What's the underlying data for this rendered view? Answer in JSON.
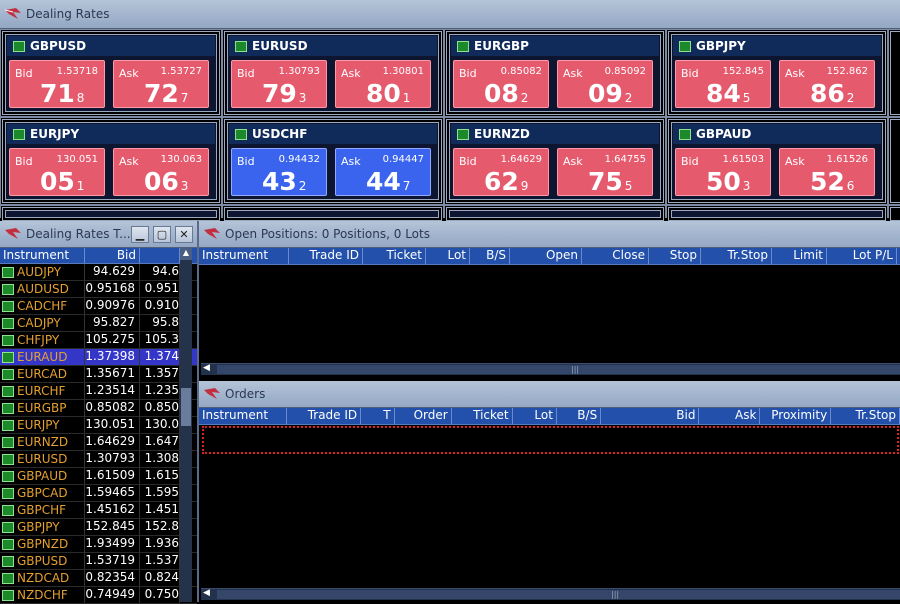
{
  "dealing_rates": {
    "title": "Dealing Rates",
    "tiles": [
      {
        "symbol": "GBPUSD",
        "bid": {
          "label": "Bid",
          "price": "1.53718",
          "big": "71",
          "small": "8"
        },
        "ask": {
          "label": "Ask",
          "price": "1.53727",
          "big": "72",
          "small": "7"
        },
        "color": "red"
      },
      {
        "symbol": "EURUSD",
        "bid": {
          "label": "Bid",
          "price": "1.30793",
          "big": "79",
          "small": "3"
        },
        "ask": {
          "label": "Ask",
          "price": "1.30801",
          "big": "80",
          "small": "1"
        },
        "color": "red"
      },
      {
        "symbol": "EURGBP",
        "bid": {
          "label": "Bid",
          "price": "0.85082",
          "big": "08",
          "small": "2"
        },
        "ask": {
          "label": "Ask",
          "price": "0.85092",
          "big": "09",
          "small": "2"
        },
        "color": "red"
      },
      {
        "symbol": "GBPJPY",
        "bid": {
          "label": "Bid",
          "price": "152.845",
          "big": "84",
          "small": "5"
        },
        "ask": {
          "label": "Ask",
          "price": "152.862",
          "big": "86",
          "small": "2"
        },
        "color": "red"
      },
      {
        "symbol": "EURJPY",
        "bid": {
          "label": "Bid",
          "price": "130.051",
          "big": "05",
          "small": "1"
        },
        "ask": {
          "label": "Ask",
          "price": "130.063",
          "big": "06",
          "small": "3"
        },
        "color": "red"
      },
      {
        "symbol": "USDCHF",
        "bid": {
          "label": "Bid",
          "price": "0.94432",
          "big": "43",
          "small": "2"
        },
        "ask": {
          "label": "Ask",
          "price": "0.94447",
          "big": "44",
          "small": "7"
        },
        "color": "blue"
      },
      {
        "symbol": "EURNZD",
        "bid": {
          "label": "Bid",
          "price": "1.64629",
          "big": "62",
          "small": "9"
        },
        "ask": {
          "label": "Ask",
          "price": "1.64755",
          "big": "75",
          "small": "5"
        },
        "color": "red"
      },
      {
        "symbol": "GBPAUD",
        "bid": {
          "label": "Bid",
          "price": "1.61503",
          "big": "50",
          "small": "3"
        },
        "ask": {
          "label": "Ask",
          "price": "1.61526",
          "big": "52",
          "small": "6"
        },
        "color": "red"
      }
    ]
  },
  "rates_table": {
    "title": "Dealing Rates T...",
    "columns": [
      "Instrument",
      "Bid",
      ""
    ],
    "rows": [
      [
        "AUDJPY",
        "94.629",
        "94.6"
      ],
      [
        "AUDUSD",
        "0.95168",
        "0.951"
      ],
      [
        "CADCHF",
        "0.90976",
        "0.910"
      ],
      [
        "CADJPY",
        "95.827",
        "95.8"
      ],
      [
        "CHFJPY",
        "105.275",
        "105.3"
      ],
      [
        "EURAUD",
        "1.37398",
        "1.374"
      ],
      [
        "EURCAD",
        "1.35671",
        "1.357"
      ],
      [
        "EURCHF",
        "1.23514",
        "1.235"
      ],
      [
        "EURGBP",
        "0.85082",
        "0.850"
      ],
      [
        "EURJPY",
        "130.051",
        "130.0"
      ],
      [
        "EURNZD",
        "1.64629",
        "1.647"
      ],
      [
        "EURUSD",
        "1.30793",
        "1.308"
      ],
      [
        "GBPAUD",
        "1.61509",
        "1.615"
      ],
      [
        "GBPCAD",
        "1.59465",
        "1.595"
      ],
      [
        "GBPCHF",
        "1.45162",
        "1.451"
      ],
      [
        "GBPJPY",
        "152.845",
        "152.8"
      ],
      [
        "GBPNZD",
        "1.93499",
        "1.936"
      ],
      [
        "GBPUSD",
        "1.53719",
        "1.537"
      ],
      [
        "NZDCAD",
        "0.82354",
        "0.824"
      ],
      [
        "NZDCHF",
        "0.74949",
        "0.750"
      ]
    ],
    "selected_index": 5
  },
  "open_positions": {
    "title": "Open Positions: 0 Positions, 0 Lots",
    "columns": [
      "Instrument",
      "Trade ID",
      "Ticket",
      "Lot",
      "B/S",
      "Open",
      "Close",
      "Stop",
      "Tr.Stop",
      "Limit",
      "Lot P/L"
    ]
  },
  "orders": {
    "title": "Orders",
    "columns": [
      "Instrument",
      "Trade ID",
      "T",
      "Order",
      "Ticket",
      "Lot",
      "B/S",
      "Bid",
      "Ask",
      "Proximity",
      "Tr.Stop"
    ]
  },
  "colors": {
    "red_quote": "#e65a6e",
    "blue_quote": "#3a64ee",
    "header_blue": "#2250aa"
  }
}
